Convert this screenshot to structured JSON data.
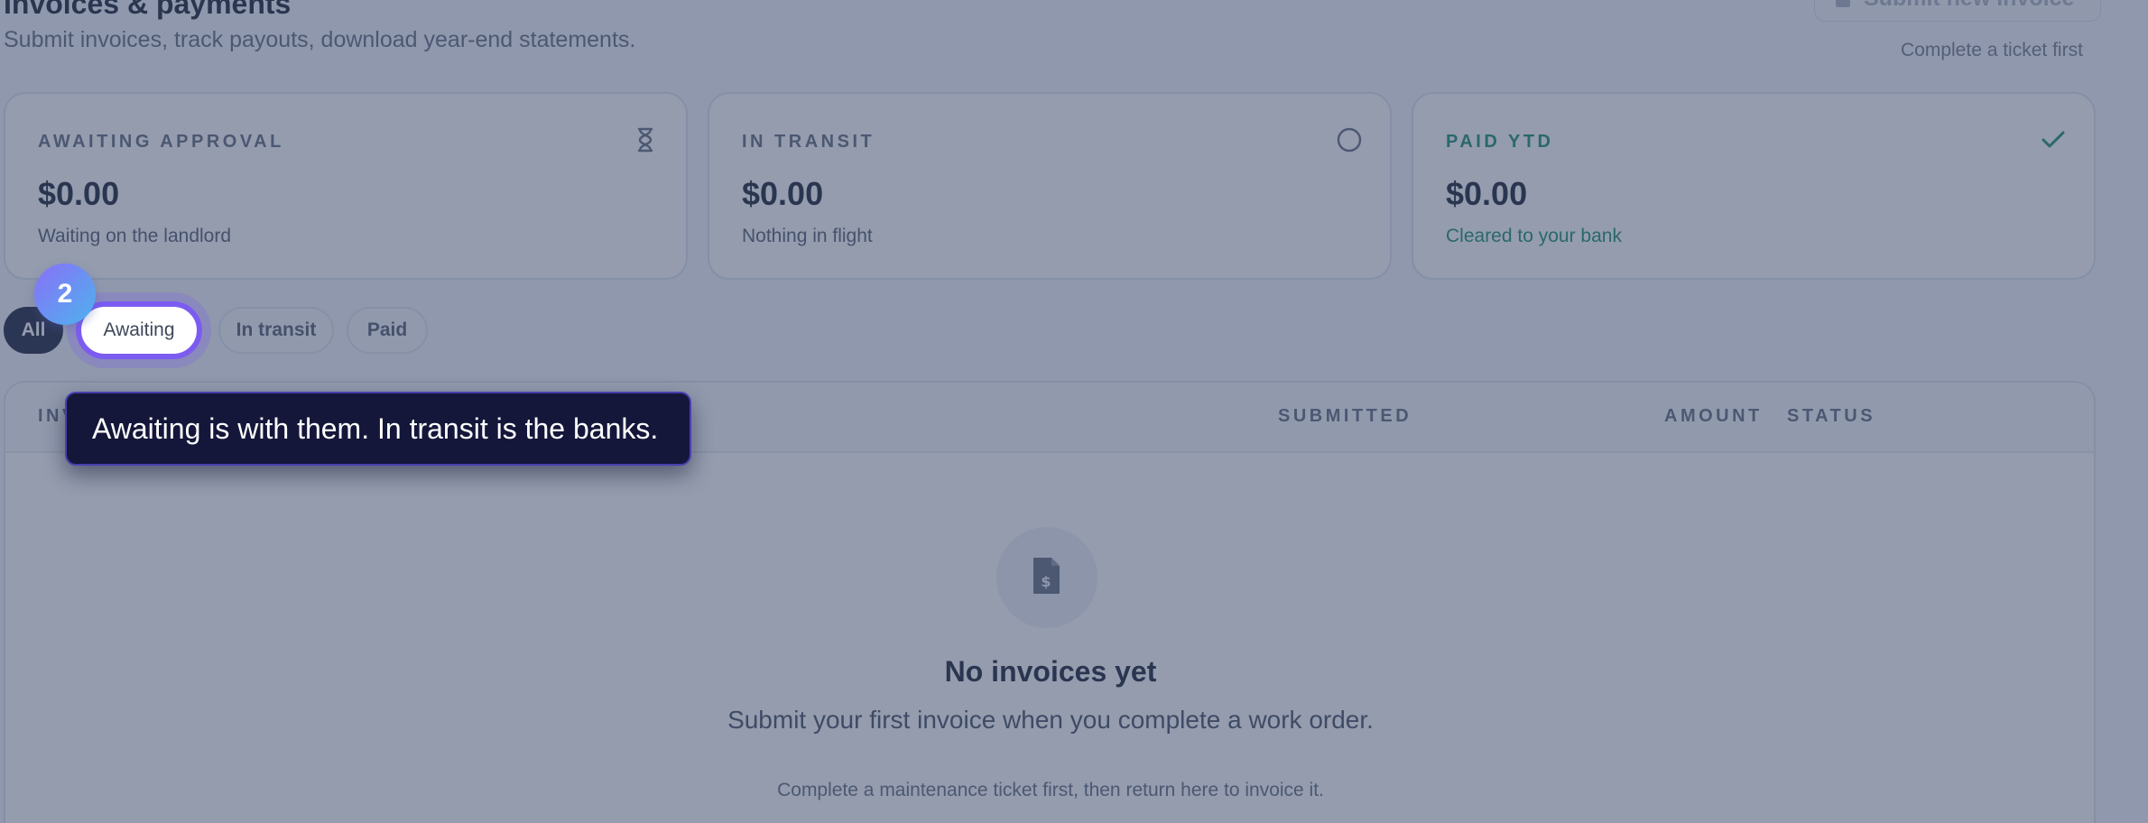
{
  "header": {
    "title": "Invoices & payments",
    "subtitle": "Submit invoices, track payouts, download year-end statements.",
    "submit_button": "Submit new invoice",
    "submit_hint": "Complete a ticket first"
  },
  "cards": [
    {
      "label": "AWAITING APPROVAL",
      "value": "$0.00",
      "note": "Waiting on the landlord",
      "icon": "hourglass-icon"
    },
    {
      "label": "IN TRANSIT",
      "value": "$0.00",
      "note": "Nothing in flight",
      "icon": "circle-icon"
    },
    {
      "label": "PAID YTD",
      "value": "$0.00",
      "note": "Cleared to your bank",
      "icon": "check-icon",
      "accent": "#0f8a6a"
    }
  ],
  "filters": {
    "items": [
      "All",
      "Awaiting",
      "In transit",
      "Paid"
    ],
    "selected": "All"
  },
  "tour": {
    "step": "2",
    "tooltip": "Awaiting is with them. In transit is the banks."
  },
  "table": {
    "columns": [
      "INV",
      "SUBMITTED",
      "AMOUNT",
      "STATUS"
    ]
  },
  "empty_state": {
    "icon": "invoice-dollar-icon",
    "title": "No invoices yet",
    "subtitle": "Submit your first invoice when you complete a work order.",
    "hint": "Complete a maintenance ticket first, then return here to invoice it."
  },
  "colors": {
    "accent": "#7c5cf0",
    "dark": "#101733",
    "paid": "#0f8a6a"
  }
}
